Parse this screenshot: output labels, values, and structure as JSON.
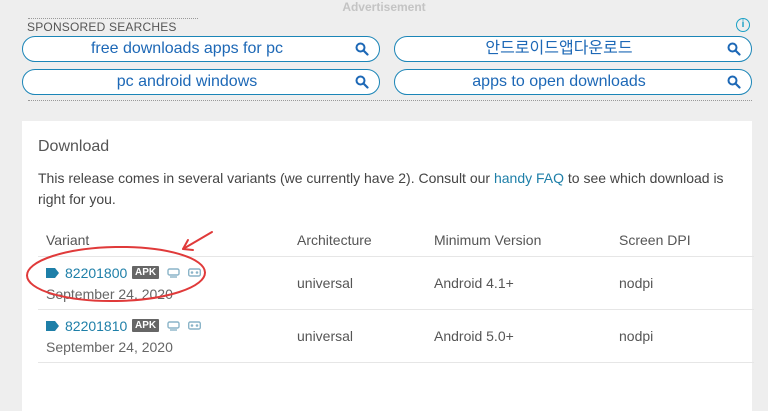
{
  "ad_label": "Advertisement",
  "sponsored": {
    "title": "SPONSORED SEARCHES",
    "info_icon": "info-icon",
    "search_icon": "magnifier-icon",
    "items": [
      {
        "label": "free downloads apps for pc"
      },
      {
        "label": "안드로이드앱다운로드"
      },
      {
        "label": "pc android windows"
      },
      {
        "label": "apps to open downloads"
      }
    ]
  },
  "download": {
    "title": "Download",
    "desc_before": "This release comes in several variants (we currently have 2). Consult our ",
    "desc_link": "handy FAQ",
    "desc_after": " to see which download is right for you.",
    "columns": {
      "variant": "Variant",
      "architecture": "Architecture",
      "min_version": "Minimum Version",
      "dpi": "Screen DPI"
    },
    "rows": [
      {
        "id": "82201800",
        "badge": "APK",
        "date": "September 24, 2020",
        "architecture": "universal",
        "min_version": "Android 4.1+",
        "dpi": "nodpi"
      },
      {
        "id": "82201810",
        "badge": "APK",
        "date": "September 24, 2020",
        "architecture": "universal",
        "min_version": "Android 5.0+",
        "dpi": "nodpi"
      }
    ]
  },
  "colors": {
    "accent": "#1e7fa8",
    "pill_border": "#1b85b7",
    "annotation": "#e03a3a"
  }
}
